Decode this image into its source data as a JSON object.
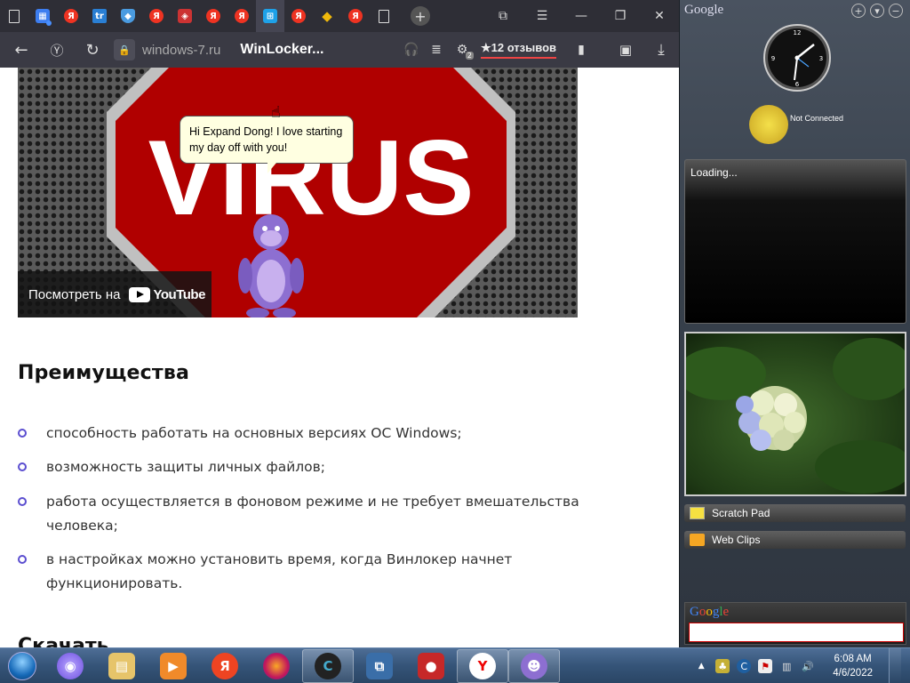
{
  "browser": {
    "tabs": [
      "doc",
      "grid",
      "ya",
      "tr",
      "shield",
      "ya",
      "cube",
      "ya",
      "ya",
      "win",
      "ya",
      "bin",
      "ya",
      "doc"
    ],
    "active_tab_index": 9,
    "window_controls": [
      "bookmarks-icon",
      "menu-icon",
      "minimize-icon",
      "restore-icon",
      "close-icon"
    ],
    "address": {
      "domain": "windows-7.ru",
      "page_title": "WinLocker...",
      "reviews": "★12 отзывов",
      "badge": "2"
    }
  },
  "content": {
    "video": {
      "watch_on": "Посмотреть на",
      "youtube": "YouTube"
    },
    "bubble_text": "Hi Expand Dong! I love starting my day off with you!",
    "heading": "Преимущества",
    "bullets": [
      "способность работать на основных версиях ОС Windows;",
      "возможность защиты личных файлов;",
      "работа осуществляется в фоновом режиме и не требует вмешательства человека;",
      "в настройках можно установить время, когда Винлокер начнет функционировать."
    ],
    "heading2": "Скачать"
  },
  "sidebar": {
    "title": "Google",
    "weather_status": "Not Connected",
    "panel_status": "Loading...",
    "gadgets": [
      "Scratch Pad",
      "Web Clips"
    ],
    "search_logo": "Google"
  },
  "taskbar": {
    "time": "6:08 AM",
    "date": "4/6/2022",
    "apps": [
      "ie-icon",
      "explorer-icon",
      "media-icon",
      "yandex-icon",
      "firefox-icon",
      "ccleaner-icon",
      "remote-icon",
      "recorder-icon",
      "yandex-browser-icon",
      "bonzi-icon"
    ]
  },
  "colors": {
    "accent": "#5b4ed0",
    "tabbar": "#2e2e36",
    "addressbar": "#3a3a44",
    "taskbar": "#355478"
  }
}
